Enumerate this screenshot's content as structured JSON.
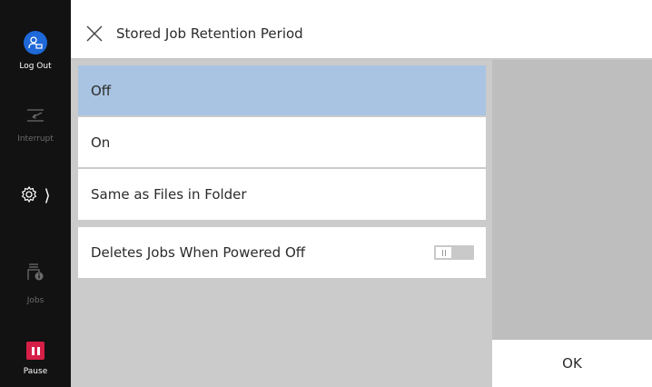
{
  "sidebar": {
    "logout_label": "Log Out",
    "interrupt_label": "Interrupt",
    "jobs_label": "Jobs",
    "pause_label": "Pause",
    "icons": [
      "user-logout-icon",
      "interrupt-icon",
      "gear-icon",
      "jobs-icon",
      "pause-icon"
    ]
  },
  "header": {
    "title": "Stored Job Retention Period"
  },
  "options": [
    {
      "label": "Off",
      "selected": true
    },
    {
      "label": "On",
      "selected": false
    },
    {
      "label": "Same as Files in Folder",
      "selected": false
    }
  ],
  "delete_setting": {
    "label": "Deletes Jobs When Powered Off",
    "toggle_on": false
  },
  "footer": {
    "ok_label": "OK"
  },
  "colors": {
    "sidebar_bg": "#121212",
    "selected_bg": "#a9c4e2",
    "logout_accent": "#1e68d8",
    "pause_accent": "#d61f47"
  }
}
